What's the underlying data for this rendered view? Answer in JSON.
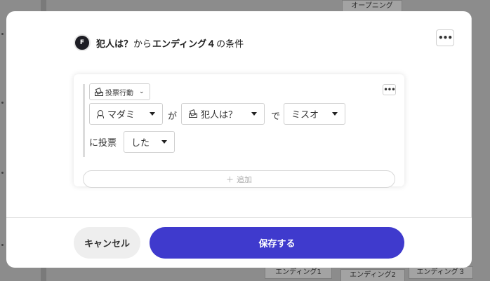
{
  "background": {
    "nodes": {
      "opening": "オープニング",
      "ending1": "エンディング1",
      "ending2": "エンディング2",
      "ending3": "エンディング３"
    }
  },
  "header": {
    "avatar_letter": "F",
    "title_part1": "犯人は？",
    "title_part2": "から",
    "title_part3": "エンディング４",
    "title_part4": "の条件",
    "menu_icon": "ellipsis-icon"
  },
  "condition": {
    "type_label": "投票行動",
    "voter": "マダミ",
    "particle_ga": "が",
    "question": "犯人は？",
    "particle_de": "で",
    "target": "ミスオ",
    "particle_vote": "に投票",
    "action": "した",
    "add_label": "追加"
  },
  "footer": {
    "cancel_label": "キャンセル",
    "save_label": "保存する"
  },
  "colors": {
    "primary": "#3f3acd",
    "cancel_bg": "#eeeeee"
  }
}
